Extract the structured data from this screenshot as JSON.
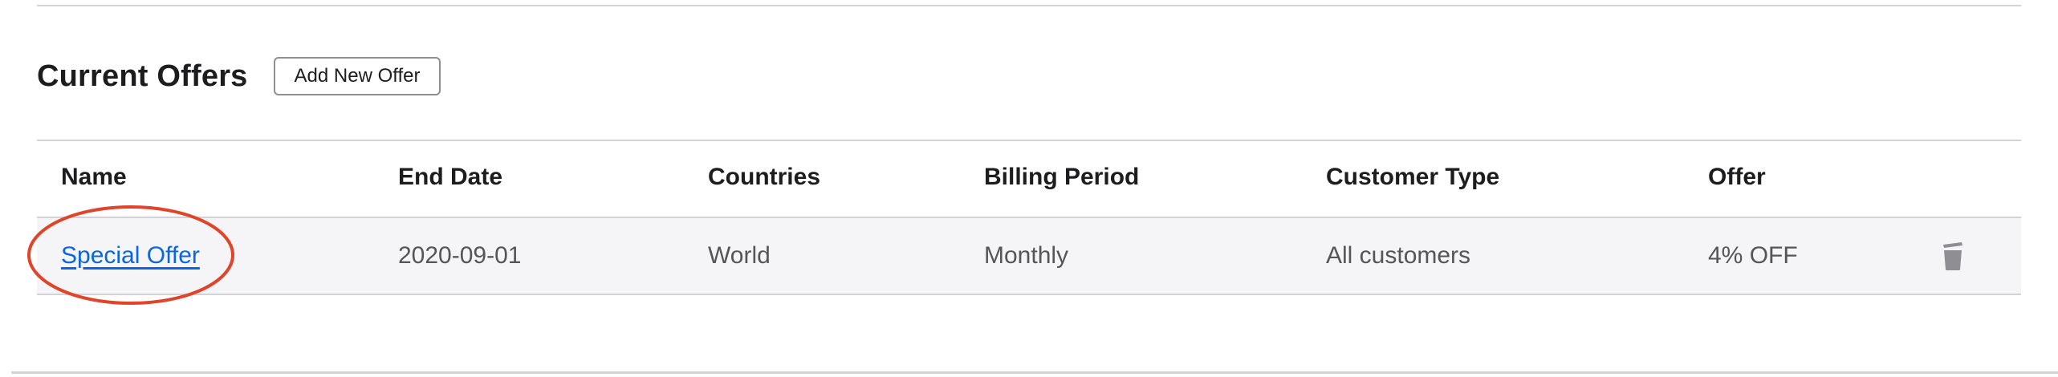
{
  "section": {
    "title": "Current Offers",
    "add_button_label": "Add New Offer"
  },
  "table": {
    "columns": [
      "Name",
      "End Date",
      "Countries",
      "Billing Period",
      "Customer Type",
      "Offer"
    ],
    "rows": [
      {
        "name": "Special Offer",
        "end_date": "2020-09-01",
        "countries": "World",
        "billing_period": "Monthly",
        "customer_type": "All customers",
        "offer": "4% OFF",
        "action_icon": "trash-icon"
      }
    ]
  },
  "colors": {
    "link": "#0a66e0",
    "highlight": "#e0442a",
    "row_background": "#f5f5f7",
    "icon": "#8e8e93"
  }
}
